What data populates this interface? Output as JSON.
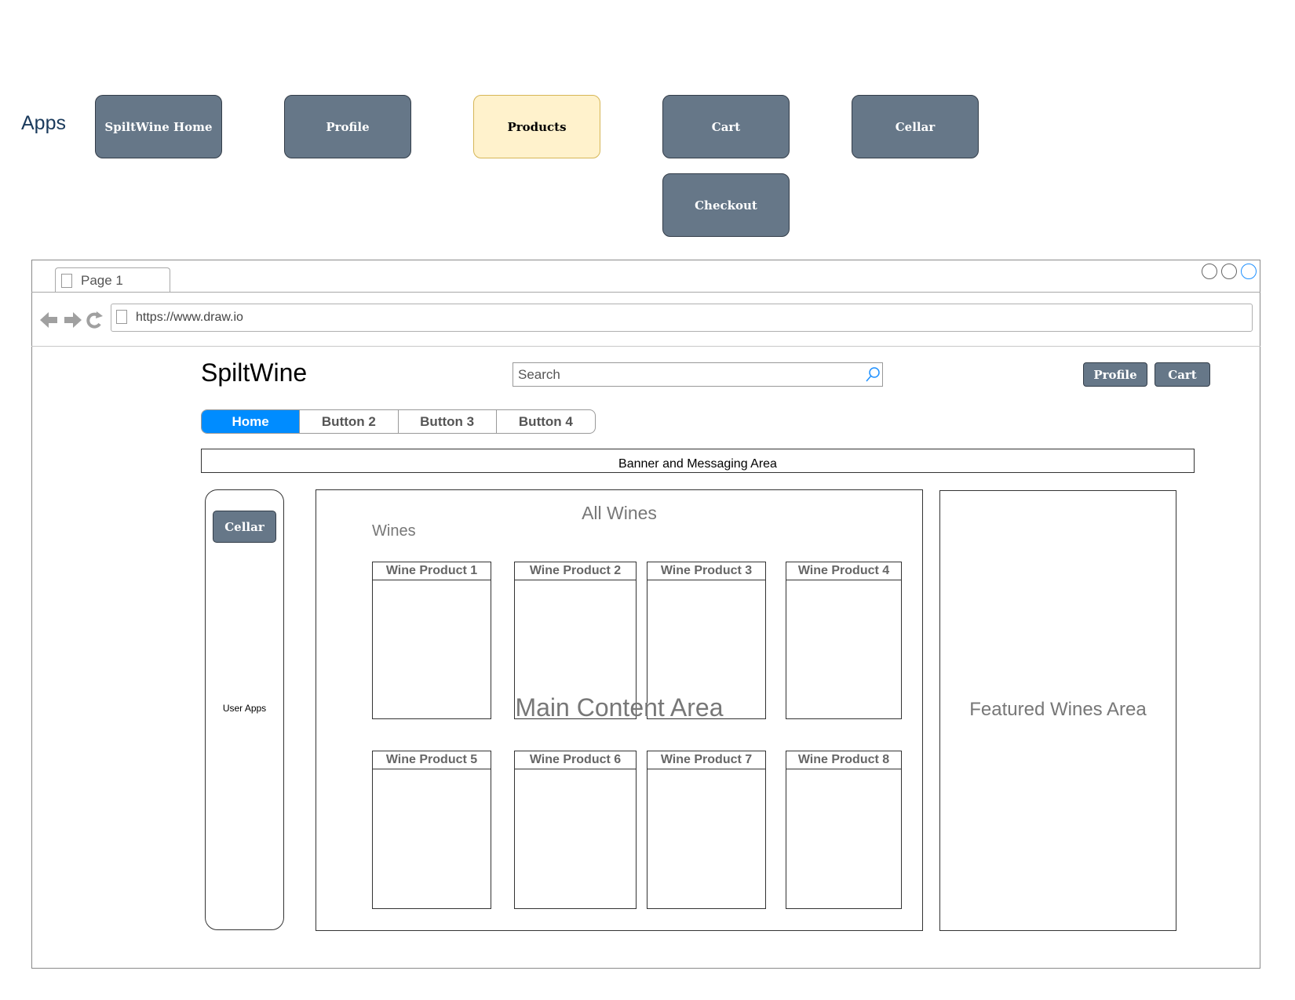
{
  "apps": {
    "label": "Apps",
    "buttons": [
      {
        "label": "SpiltWine Home",
        "active": false
      },
      {
        "label": "Profile",
        "active": false
      },
      {
        "label": "Products",
        "active": true
      },
      {
        "label": "Cart",
        "active": false
      },
      {
        "label": "Cellar",
        "active": false
      },
      {
        "label": "Checkout",
        "active": false
      }
    ]
  },
  "browser": {
    "tab_label": "Page 1",
    "url": "https://www.draw.io"
  },
  "site": {
    "brand": "SpiltWine",
    "search_placeholder": "Search",
    "header_buttons": {
      "profile": "Profile",
      "cart": "Cart"
    },
    "nav": [
      {
        "label": "Home",
        "active": true
      },
      {
        "label": "Button 2",
        "active": false
      },
      {
        "label": "Button 3",
        "active": false
      },
      {
        "label": "Button 4",
        "active": false
      }
    ],
    "banner": "Banner and Messaging Area",
    "sidebar": {
      "cellar_button": "Cellar",
      "label": "User Apps"
    },
    "main": {
      "title": "All Wines",
      "section_label": "Wines",
      "area_label": "Main Content Area",
      "products": [
        "Wine Product 1",
        "Wine Product 2",
        "Wine Product 3",
        "Wine Product 4",
        "Wine Product 5",
        "Wine Product 6",
        "Wine Product 7",
        "Wine Product 8"
      ]
    },
    "featured_label": "Featured Wines Area"
  },
  "colors": {
    "app_button": "#667788",
    "app_button_active": "#fff2cc",
    "nav_active": "#008cff"
  }
}
